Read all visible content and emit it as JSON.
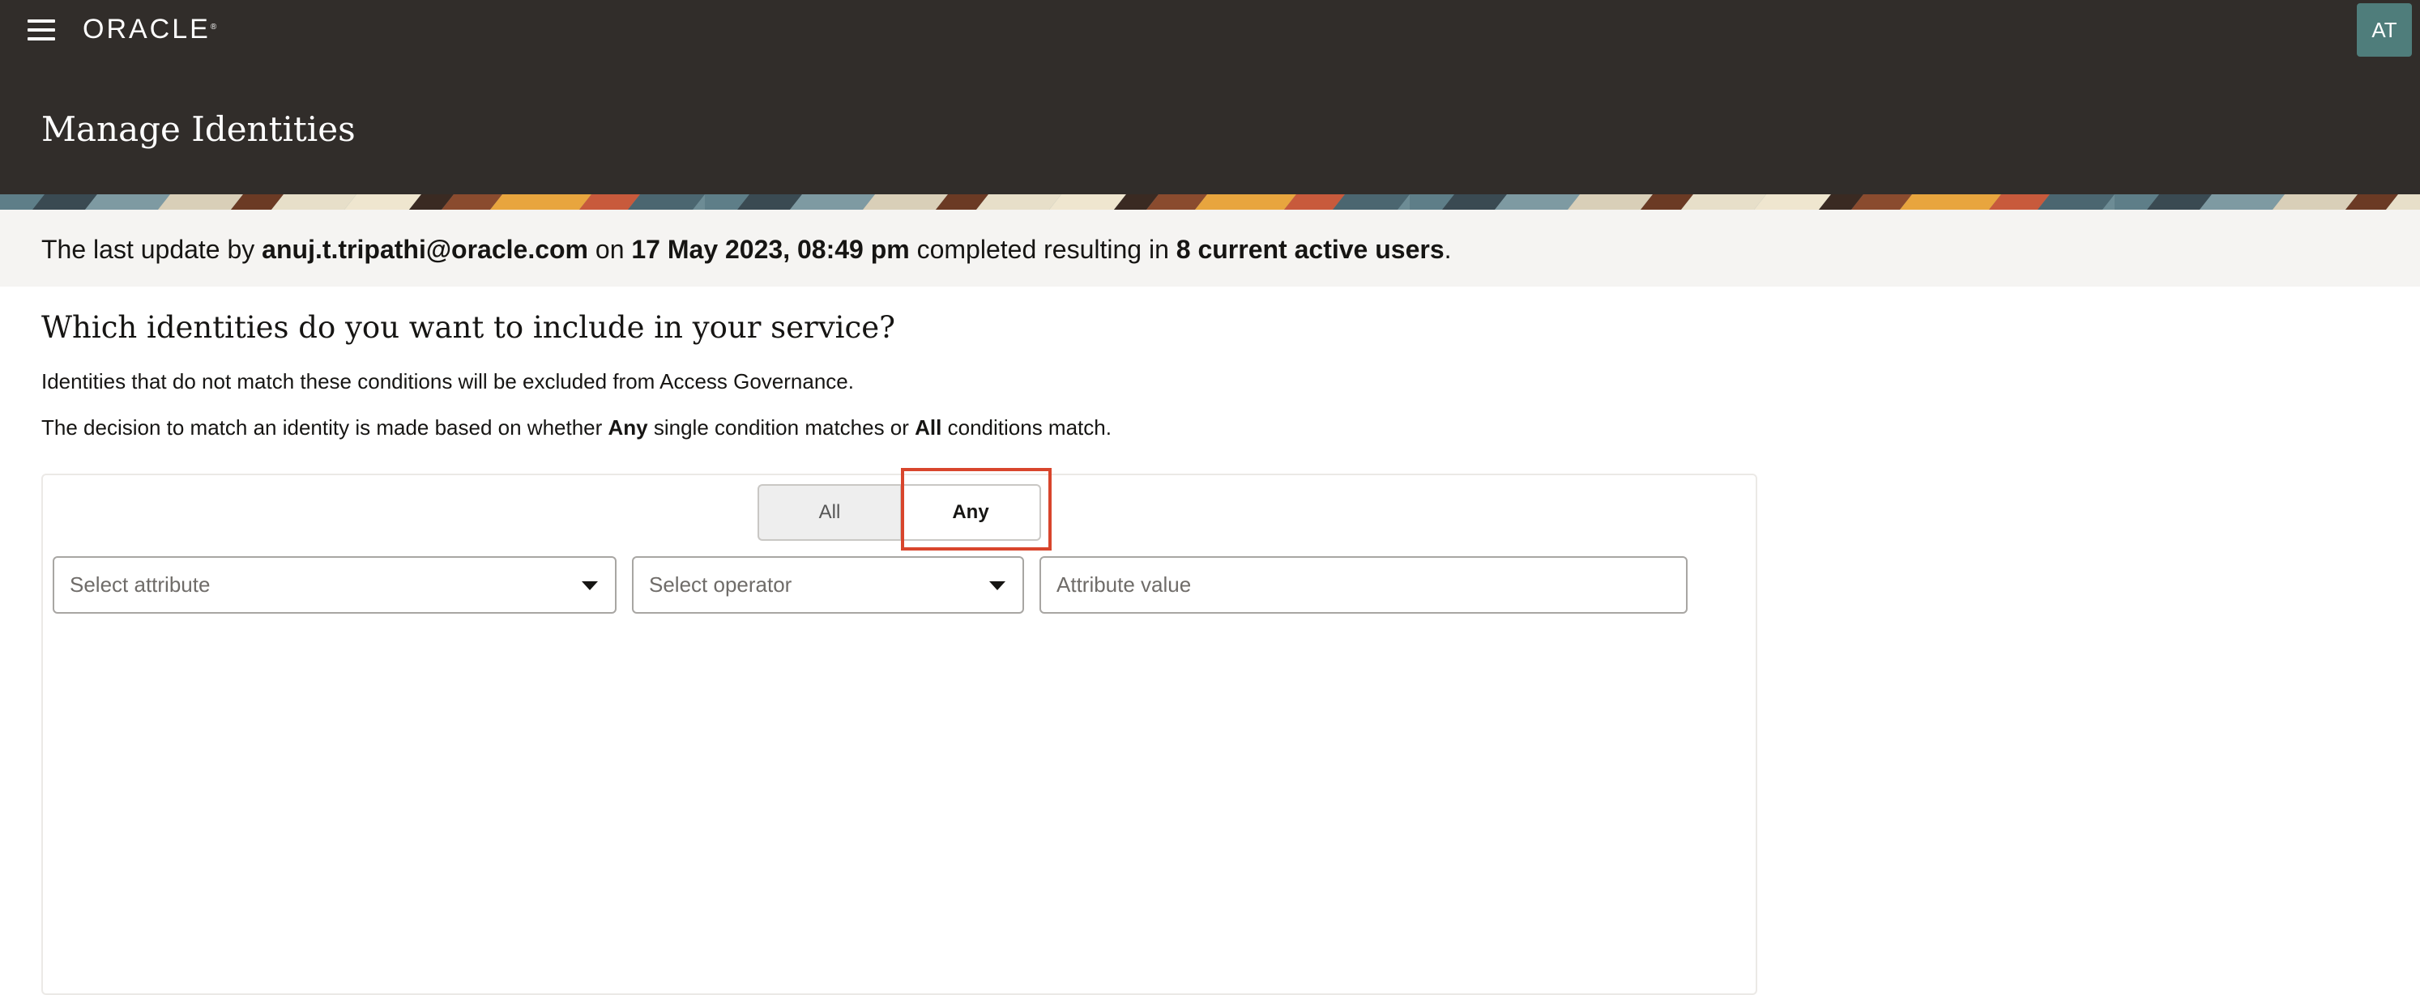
{
  "header": {
    "brand": "ORACLE",
    "brand_mark": "®",
    "page_title": "Manage Identities",
    "user_initials": "AT",
    "menu_icon": "hamburger-menu-icon"
  },
  "status": {
    "prefix": "The last update by ",
    "user": "anuj.t.tripathi@oracle.com",
    "on": " on ",
    "timestamp": "17 May 2023, 08:49 pm",
    "middle": " completed resulting in ",
    "result": "8 current active users",
    "suffix": "."
  },
  "main": {
    "question": "Which identities do you want to include in your service?",
    "note": "Identities that do not match these conditions will be excluded from Access Governance.",
    "decision_prefix": "The decision to match an identity is made based on whether ",
    "decision_any": "Any",
    "decision_middle": " single condition matches or ",
    "decision_all": "All",
    "decision_suffix": " conditions match."
  },
  "match_toggle": {
    "options": [
      "All",
      "Any"
    ],
    "selected": "Any"
  },
  "condition": {
    "attribute_placeholder": "Select attribute",
    "operator_placeholder": "Select operator",
    "value_placeholder": "Attribute value"
  },
  "colors": {
    "header_bg": "#312d2a",
    "status_bg": "#f5f4f2",
    "highlight": "#d8452c",
    "avatar_bg": "#4f7d7b"
  }
}
